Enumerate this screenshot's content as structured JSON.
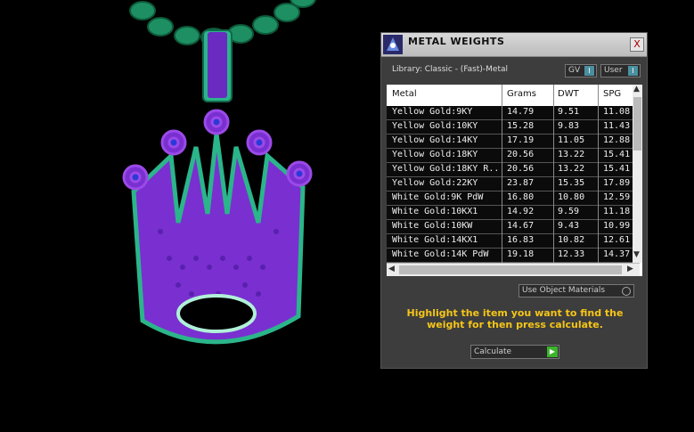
{
  "panel": {
    "title": "METAL WEIGHTS",
    "close_label": "X",
    "library": "Library: Classic - (Fast)-Metal",
    "gv_label": "GV",
    "user_label": "User",
    "toggle_glyph": "I"
  },
  "table": {
    "headers": [
      "Metal",
      "Grams",
      "DWT",
      "SPG"
    ],
    "rows": [
      [
        "Yellow Gold:9KY",
        "14.79",
        "9.51",
        "11.08"
      ],
      [
        "Yellow Gold:10KY",
        "15.28",
        "9.83",
        "11.43"
      ],
      [
        "Yellow Gold:14KY",
        "17.19",
        "11.05",
        "12.88"
      ],
      [
        "Yellow Gold:18KY",
        "20.56",
        "13.22",
        "15.41"
      ],
      [
        "Yellow Gold:18KY R...",
        "20.56",
        "13.22",
        "15.41"
      ],
      [
        "Yellow Gold:22KY",
        "23.87",
        "15.35",
        "17.89"
      ],
      [
        "White Gold:9K PdW",
        "16.80",
        "10.80",
        "12.59"
      ],
      [
        "White Gold:10KX1",
        "14.92",
        "9.59",
        "11.18"
      ],
      [
        "White Gold:10KW",
        "14.67",
        "9.43",
        "10.99"
      ],
      [
        "White Gold:14KX1",
        "16.83",
        "10.82",
        "12.61"
      ],
      [
        "White Gold:14K PdW",
        "19.18",
        "12.33",
        "14.37"
      ]
    ]
  },
  "controls": {
    "use_object_materials": "Use Object Materials",
    "hint": "Highlight the item you want to find the weight for then press calculate.",
    "calculate_label": "Calculate"
  },
  "colors": {
    "hint": "#f5c518",
    "accent_green": "#3bb32b",
    "pendant_purple": "#7a2fd1",
    "pendant_teal": "#2bb58a"
  }
}
